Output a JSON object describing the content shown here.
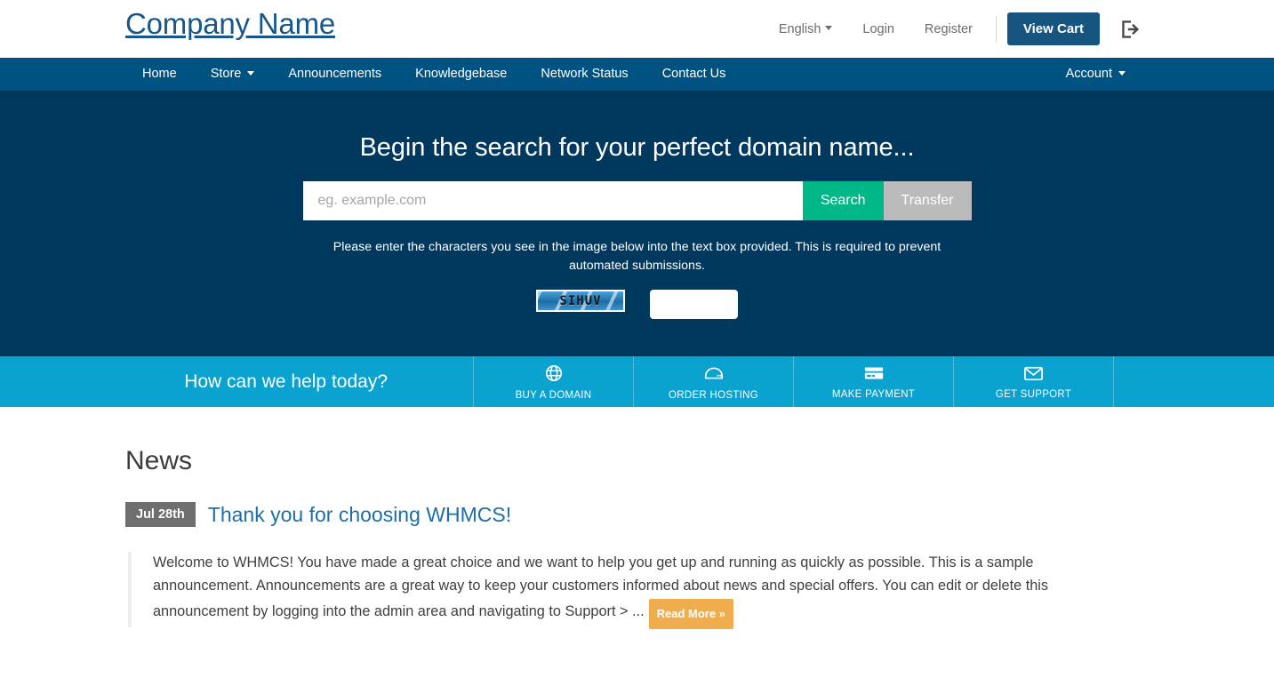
{
  "header": {
    "brand": "Company Name",
    "language": "English",
    "login": "Login",
    "register": "Register",
    "view_cart": "View Cart",
    "logout_icon": "logout-icon"
  },
  "nav": {
    "items": [
      {
        "label": "Home",
        "has_caret": false
      },
      {
        "label": "Store",
        "has_caret": true
      },
      {
        "label": "Announcements",
        "has_caret": false
      },
      {
        "label": "Knowledgebase",
        "has_caret": false
      },
      {
        "label": "Network Status",
        "has_caret": false
      },
      {
        "label": "Contact Us",
        "has_caret": false
      }
    ],
    "account": "Account"
  },
  "hero": {
    "title": "Begin the search for your perfect domain name...",
    "search_placeholder": "eg. example.com",
    "search_value": "",
    "search_button": "Search",
    "transfer_button": "Transfer",
    "captcha_help": "Please enter the characters you see in the image below into the text box provided. This is required to prevent automated submissions.",
    "captcha_code": "SIHUV",
    "captcha_value": "",
    "captcha_placeholder": ""
  },
  "help_bar": {
    "title": "How can we help today?",
    "actions": [
      {
        "label": "BUY A DOMAIN",
        "icon": "globe-icon"
      },
      {
        "label": "ORDER HOSTING",
        "icon": "server-icon"
      },
      {
        "label": "MAKE PAYMENT",
        "icon": "credit-card-icon"
      },
      {
        "label": "GET SUPPORT",
        "icon": "envelope-icon"
      }
    ]
  },
  "news": {
    "heading": "News",
    "items": [
      {
        "date": "Jul 28th",
        "title": "Thank you for choosing WHMCS!",
        "body": "Welcome to WHMCS! You have made a great choice and we want to help you get up and running as quickly as possible. This is a sample announcement. Announcements are a great way to keep your customers informed about news and special offers. You can edit or delete this announcement by logging into the admin area and navigating to Support > ...",
        "read_more": "Read More »"
      }
    ]
  },
  "colors": {
    "brand_blue": "#18578a",
    "nav_blue": "#005380",
    "hero_blue": "#01395e",
    "help_bar_cyan": "#0aa2cf",
    "search_green": "#00b787",
    "transfer_gray": "#bbbbbb",
    "cart_blue": "#16557f",
    "read_more_orange": "#f0ad4e",
    "date_gray": "#6e6e6e",
    "link_blue": "#1d6fa5"
  }
}
